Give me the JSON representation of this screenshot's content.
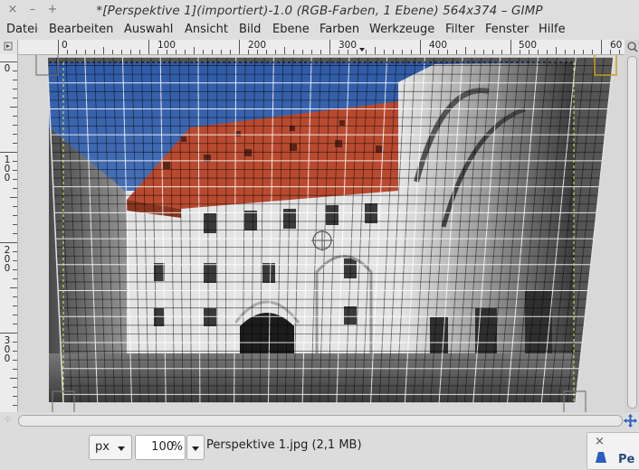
{
  "window": {
    "title": "*[Perspektive 1](importiert)-1.0 (RGB-Farben, 1 Ebene) 564x374 – GIMP",
    "close_glyph": "×",
    "minimize_glyph": "–",
    "maximize_glyph": "+"
  },
  "menu": [
    "Datei",
    "Bearbeiten",
    "Auswahl",
    "Ansicht",
    "Bild",
    "Ebene",
    "Farben",
    "Werkzeuge",
    "Filter",
    "Fenster",
    "Hilfe"
  ],
  "ruler": {
    "h_labels": [
      "0",
      "100",
      "200",
      "300",
      "400",
      "500",
      "60"
    ],
    "v_labels": [
      "0",
      "100",
      "200",
      "300"
    ]
  },
  "status": {
    "unit": "px",
    "zoom": "100",
    "zoom_unit": "%",
    "file_info": "Perspektive 1.jpg (2,1 MB)"
  },
  "panel": {
    "close_glyph": "×",
    "label": "Pe"
  },
  "colors": {
    "accent_handle": "#c8a020",
    "grid": "#ffffff",
    "roof": "#b84a30",
    "sky": "#3f6cb8"
  },
  "icons": [
    "close-icon",
    "minimize-icon",
    "maximize-icon",
    "navigate-icon",
    "zoom-fit-icon",
    "dropdown-arrow-icon",
    "quickmask-icon"
  ]
}
